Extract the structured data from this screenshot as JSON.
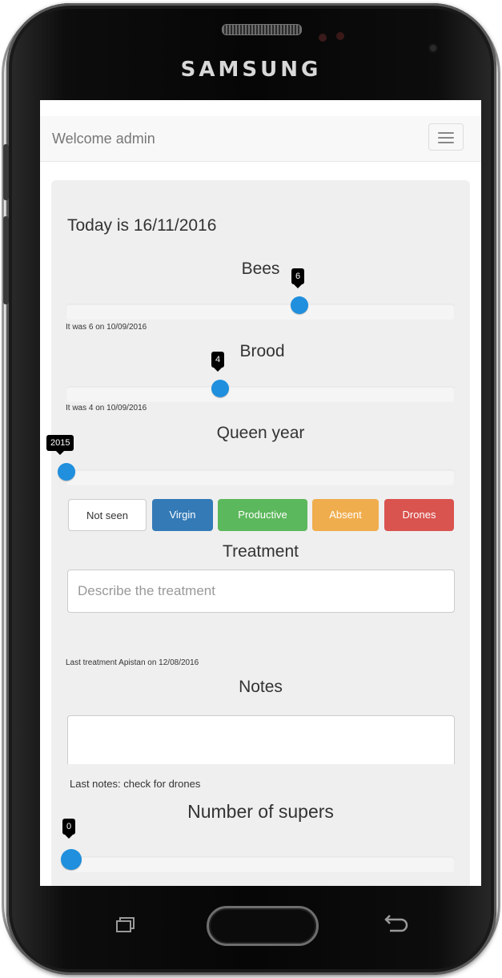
{
  "device": {
    "brand": "SAMSUNG"
  },
  "navbar": {
    "title": "Welcome admin"
  },
  "form": {
    "today": "Today is 16/11/2016",
    "bees": {
      "label": "Bees",
      "value": "6",
      "history": "It was 6 on 10/09/2016"
    },
    "brood": {
      "label": "Brood",
      "value": "4",
      "history": "It was 4 on 10/09/2016"
    },
    "queen_year": {
      "label": "Queen year",
      "value": "2015"
    },
    "queen_status": {
      "buttons": [
        {
          "label": "Not seen",
          "color": "#ffffff"
        },
        {
          "label": "Virgin",
          "color": "#337ab7"
        },
        {
          "label": "Productive",
          "color": "#5cb85c"
        },
        {
          "label": "Absent",
          "color": "#f0ad4e"
        },
        {
          "label": "Drones",
          "color": "#d9534f"
        }
      ]
    },
    "treatment": {
      "label": "Treatment",
      "placeholder": "Describe the treatment",
      "last": "Last treatment Apistan on 12/08/2016"
    },
    "notes": {
      "label": "Notes",
      "last": "Last notes: check for drones"
    },
    "supers": {
      "label": "Number of supers",
      "value": "0"
    }
  },
  "colors": {
    "slider_knob": "#1f8fde",
    "panel": "#efefef"
  },
  "icons": {
    "menu": "hamburger-menu-icon",
    "recent": "recent-apps-icon",
    "back": "back-icon"
  }
}
